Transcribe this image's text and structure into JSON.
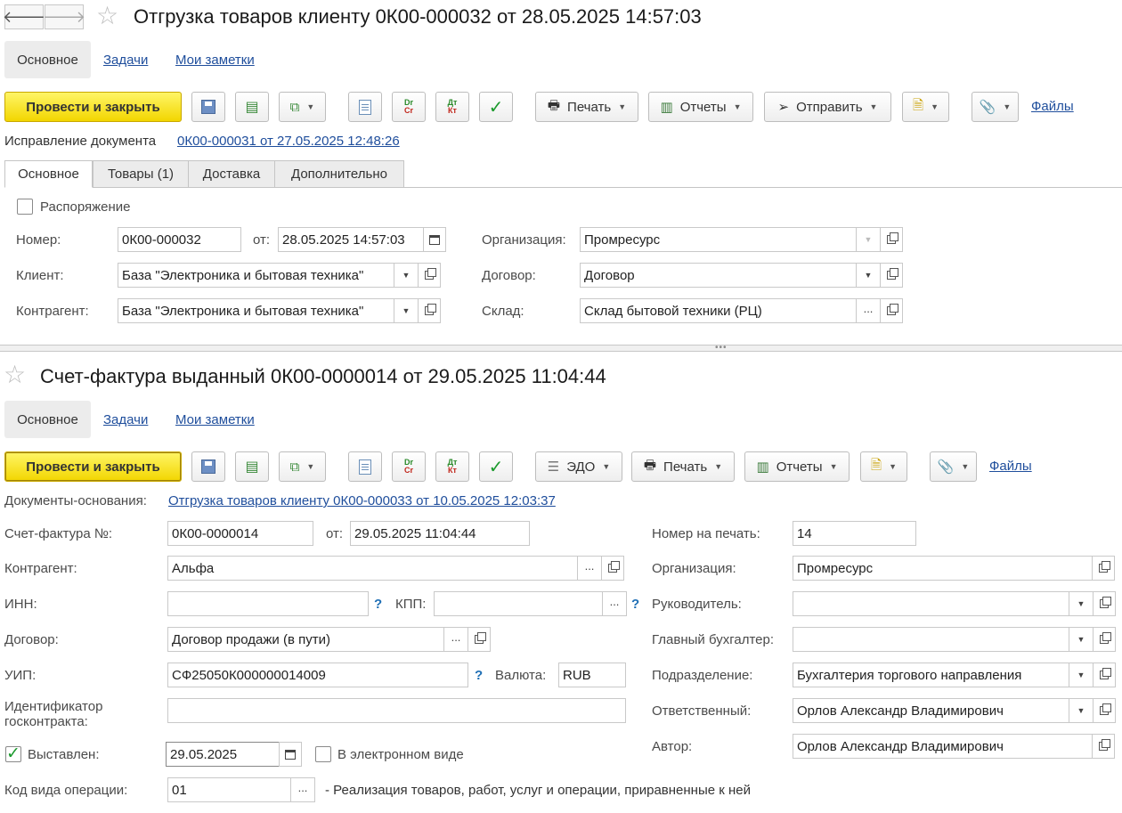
{
  "doc1": {
    "title": "Отгрузка товаров клиенту 0К00-000032 от 28.05.2025 14:57:03",
    "subtabs": [
      "Основное",
      "Задачи",
      "Мои заметки"
    ],
    "toolbar": {
      "post_close": "Провести и закрыть",
      "print": "Печать",
      "reports": "Отчеты",
      "send": "Отправить",
      "files": "Файлы",
      "dr": "Dr",
      "cr": "Cr",
      "dt": "Дт",
      "kt": "Кт"
    },
    "correction_label": "Исправление документа",
    "correction_link": "0К00-000031 от 27.05.2025 12:48:26",
    "tabs": [
      "Основное",
      "Товары (1)",
      "Доставка",
      "Дополнительно"
    ],
    "rasp_label": "Распоряжение",
    "fields": {
      "number_label": "Номер:",
      "number": "0К00-000032",
      "from_label": "от:",
      "date": "28.05.2025 14:57:03",
      "client_label": "Клиент:",
      "client": "База \"Электроника и бытовая техника\"",
      "counterparty_label": "Контрагент:",
      "counterparty": "База \"Электроника и бытовая техника\"",
      "org_label": "Организация:",
      "org": "Промресурс",
      "contract_label": "Договор:",
      "contract": "Договор",
      "warehouse_label": "Склад:",
      "warehouse": "Склад бытовой техники (РЦ)"
    }
  },
  "doc2": {
    "title": "Счет-фактура выданный 0К00-0000014 от 29.05.2025 11:04:44",
    "subtabs": [
      "Основное",
      "Задачи",
      "Мои заметки"
    ],
    "toolbar": {
      "post_close": "Провести и закрыть",
      "edo": "ЭДО",
      "print": "Печать",
      "reports": "Отчеты",
      "files": "Файлы",
      "dr": "Dr",
      "cr": "Cr",
      "dt": "Дт",
      "kt": "Кт"
    },
    "base_label": "Документы-основания:",
    "base_link": "Отгрузка товаров клиенту 0К00-000033 от 10.05.2025 12:03:37",
    "fields": {
      "invoice_label": "Счет-фактура №:",
      "invoice": "0К00-0000014",
      "from_label": "от:",
      "date": "29.05.2025 11:04:44",
      "counterparty_label": "Контрагент:",
      "counterparty": "Альфа",
      "inn_label": "ИНН:",
      "inn": "",
      "kpp_label": "КПП:",
      "kpp": "",
      "contract_label": "Договор:",
      "contract": "Договор продажи (в пути)",
      "uip_label": "УИП:",
      "uip": "СФ25050К000000014009",
      "currency_label": "Валюта:",
      "currency": "RUB",
      "gov_label_1": "Идентификатор",
      "gov_label_2": "госконтракта:",
      "gov": "",
      "issued_label": "Выставлен:",
      "issued_date": "29.05.2025",
      "electronic_label": "В электронном виде",
      "opcode_label": "Код вида операции:",
      "opcode": "01",
      "opcode_desc": "- Реализация товаров, работ, услуг и операции, приравненные к ней",
      "print_no_label": "Номер на печать:",
      "print_no": "14",
      "org_label": "Организация:",
      "org": "Промресурс",
      "head_label": "Руководитель:",
      "head": "",
      "chief_acc_label": "Главный бухгалтер:",
      "chief_acc": "",
      "division_label": "Подразделение:",
      "division": "Бухгалтерия торгового направления",
      "responsible_label": "Ответственный:",
      "responsible": "Орлов Александр Владимирович",
      "author_label": "Автор:",
      "author": "Орлов Александр Владимирович"
    }
  },
  "help_mark": "?"
}
